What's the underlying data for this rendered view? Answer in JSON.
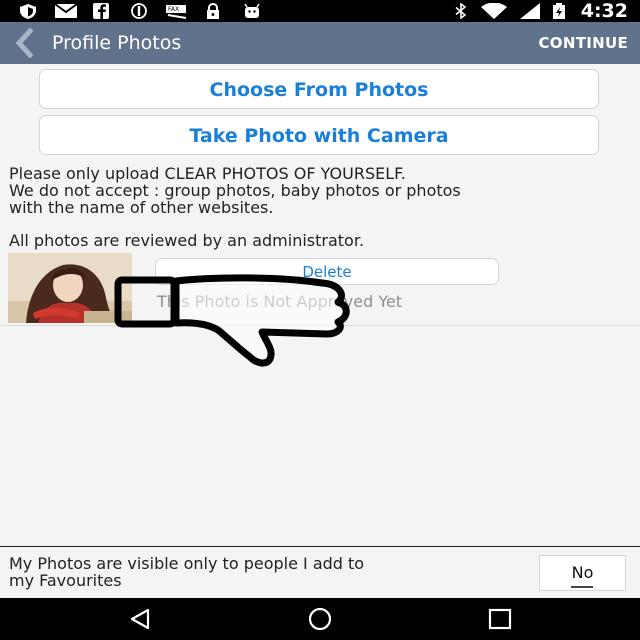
{
  "status_bar": {
    "time": "4:32",
    "icons": [
      "shield-icon",
      "mail-icon",
      "facebook-icon",
      "sync-icon",
      "fax-icon",
      "lock-icon",
      "android-icon",
      "bluetooth-icon",
      "wifi-icon",
      "battery-icon"
    ]
  },
  "action_bar": {
    "title": "Profile Photos",
    "continue_label": "CONTINUE",
    "back_icon": "back-arrow-icon"
  },
  "buttons": {
    "choose_from_photos": "Choose From Photos",
    "take_photo": "Take Photo with Camera"
  },
  "notice": {
    "line1": "Please only upload CLEAR PHOTOS OF YOURSELF.",
    "line2": "We do not accept : group photos, baby photos or photos",
    "line3": "with the name of other websites.",
    "reviewed": "All photos are reviewed by an administrator."
  },
  "photo_item": {
    "delete_label": "Delete",
    "status": "This Photo is Not Approved Yet",
    "overlay_icon": "thumbs-down-icon"
  },
  "footer": {
    "visibility_line1": "My Photos are visible only to people I add to",
    "visibility_line2": "my Favourites",
    "toggle_value": "No"
  },
  "nav_bar": {
    "icons": [
      "back-triangle-icon",
      "home-circle-icon",
      "recents-square-icon"
    ]
  },
  "colors": {
    "action_bar": "#60728c",
    "button_text": "#1a7fd6",
    "status_text": "#8f8f8f"
  }
}
